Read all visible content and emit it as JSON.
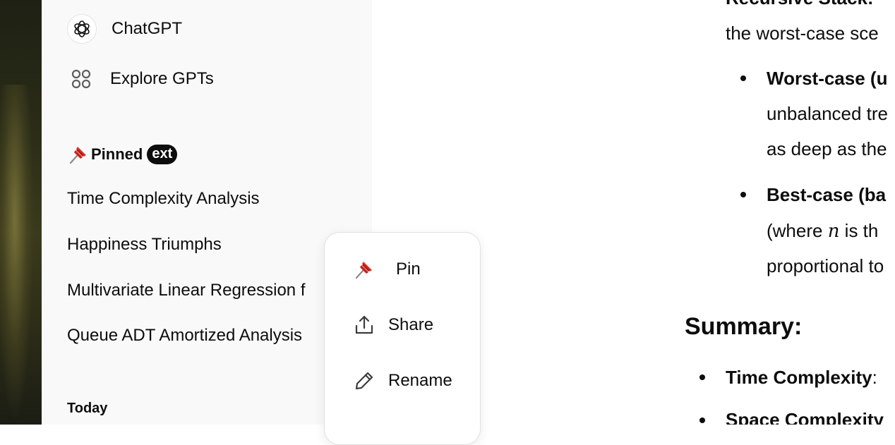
{
  "sidebar": {
    "nav": {
      "chatgpt_label": "ChatGPT",
      "explore_label": "Explore GPTs"
    },
    "pinned": {
      "title": "Pinned",
      "badge": "ext",
      "items": [
        "Time Complexity Analysis",
        "Happiness Triumphs",
        "Multivariate Linear Regression f",
        "Queue ADT Amortized Analysis"
      ]
    },
    "today_label": "Today"
  },
  "context_menu": {
    "items": [
      {
        "label": "Pin",
        "icon": "pin-icon"
      },
      {
        "label": "Share",
        "icon": "share-icon"
      },
      {
        "label": "Rename",
        "icon": "pencil-icon"
      }
    ]
  },
  "content": {
    "line_top": "Recursive Stack:",
    "line_worst_intro": "the worst-case sce",
    "worst_bold": "Worst-case (u",
    "worst_line2": "unbalanced tre",
    "worst_line3": "as deep as the",
    "best_bold": "Best-case (ba",
    "best_line2_prefix": "(where ",
    "best_line2_var": "n",
    "best_line2_suffix": " is th",
    "best_line3": "proportional to",
    "summary_heading": "Summary:",
    "time_bold": "Time Complexity",
    "time_colon": ":",
    "space_bold": "Space Complexity"
  },
  "colors": {
    "sidebar_bg": "#f9f9f9",
    "text": "#0d0d0d",
    "pin_red": "#e0332b"
  }
}
